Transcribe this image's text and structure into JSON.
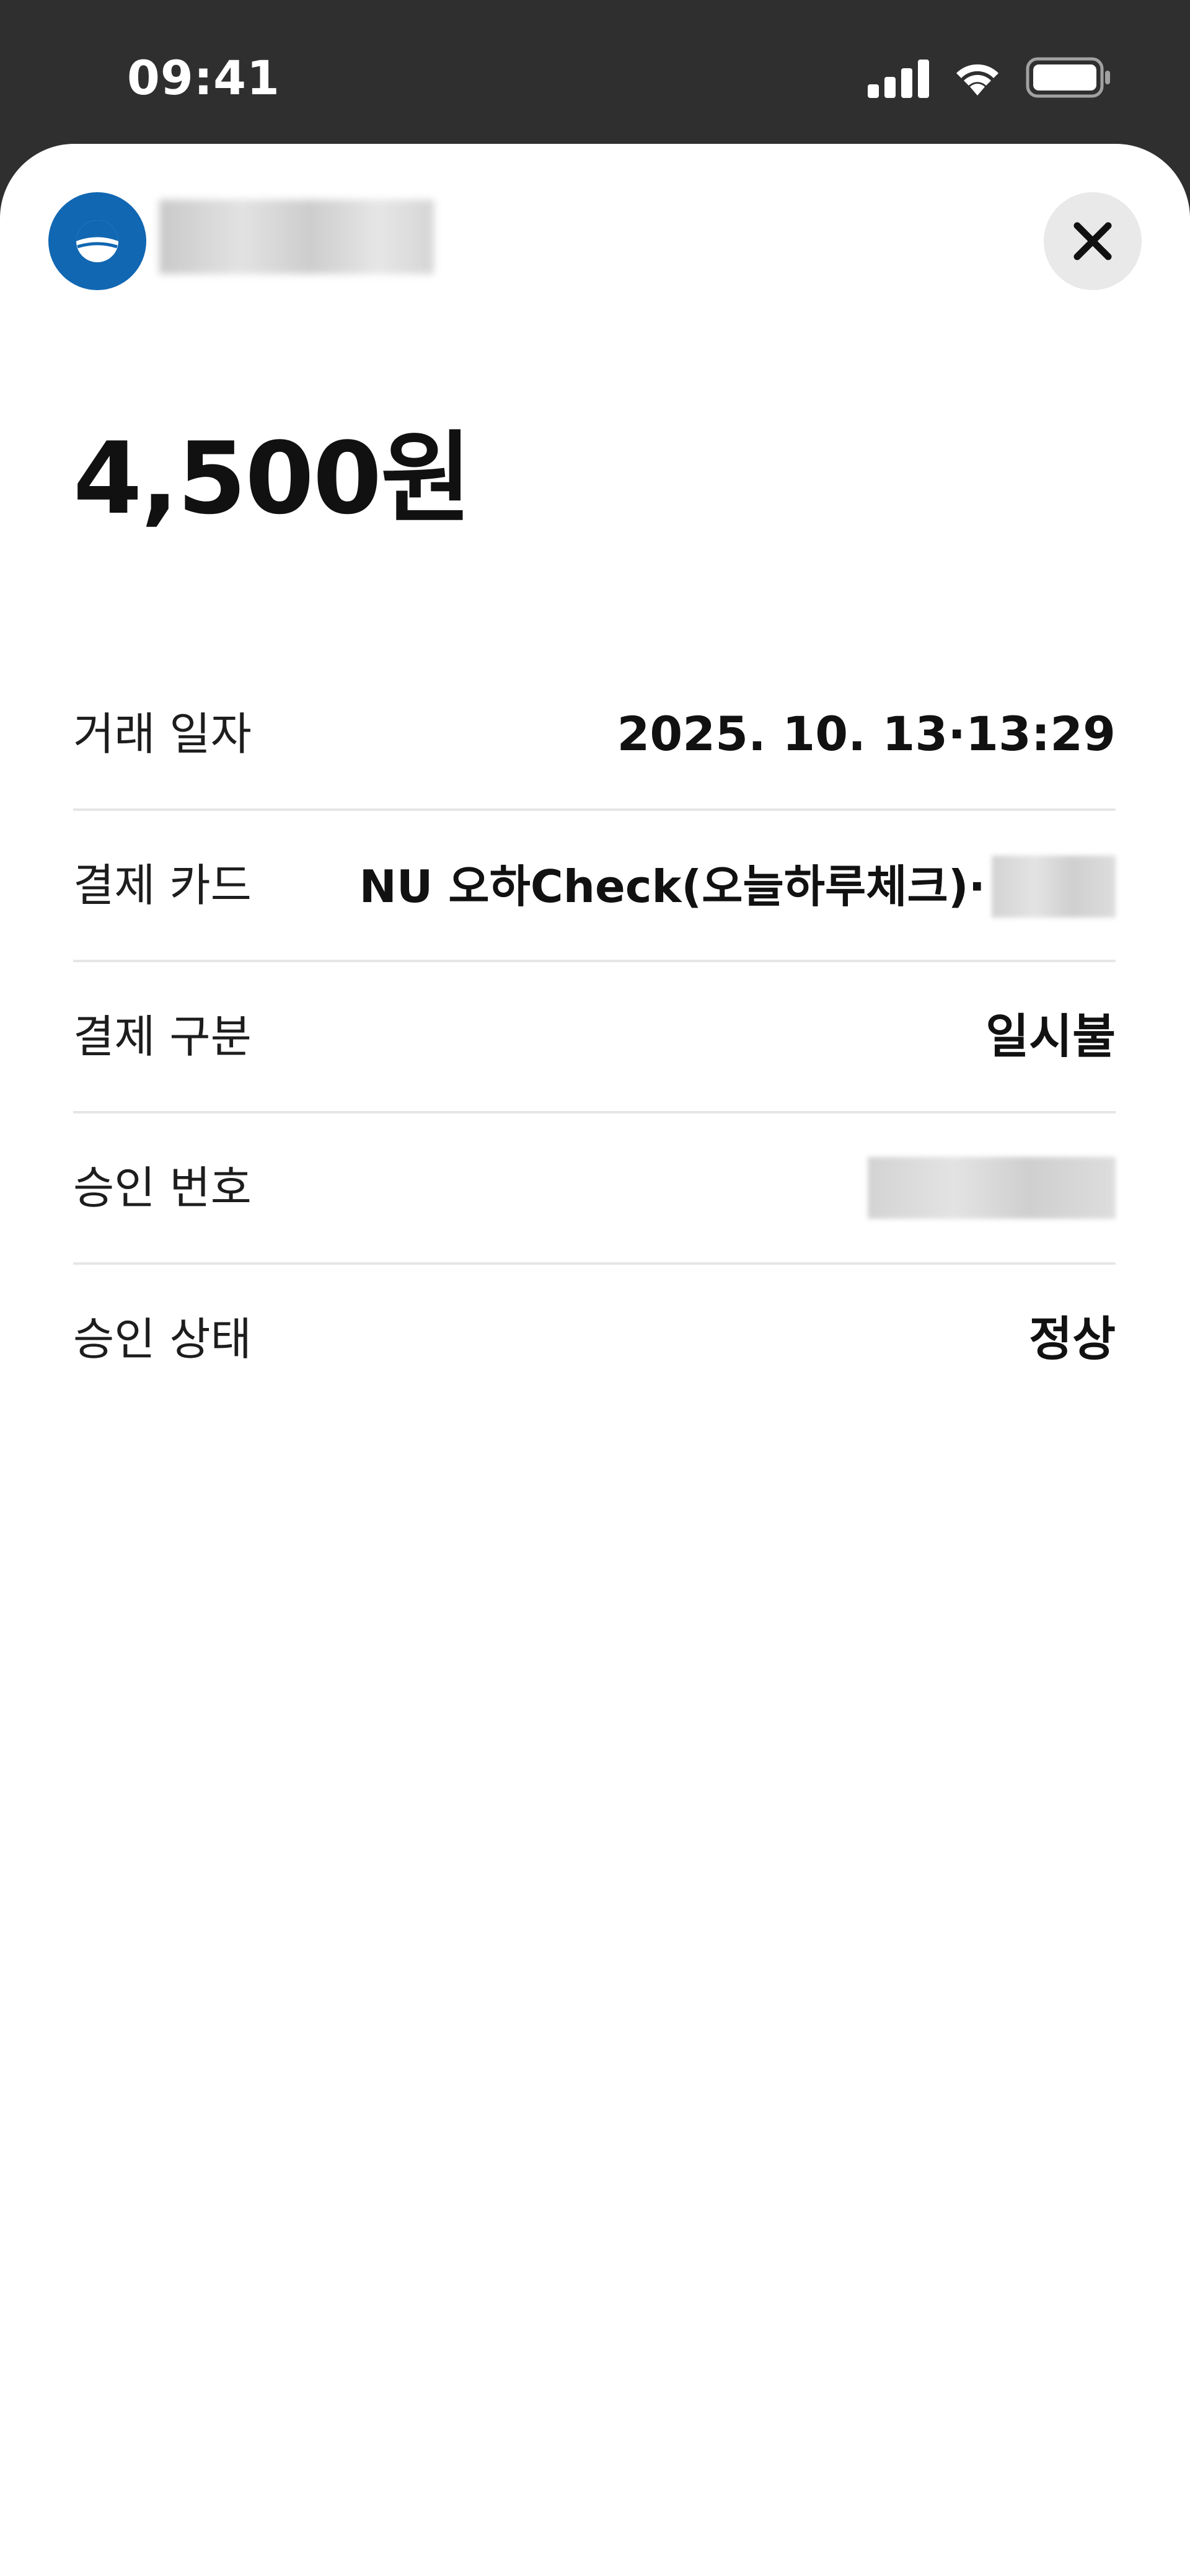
{
  "status_bar": {
    "time": "09:41",
    "icons": [
      "cellular-signal-icon",
      "wifi-icon",
      "battery-icon"
    ]
  },
  "merchant": {
    "logo_icon": "merchant-logo-icon",
    "name_redacted": true
  },
  "close_icon": "close-icon",
  "amount": "4,500원",
  "details": {
    "transaction_date": {
      "label": "거래 일자",
      "value": "2025. 10. 13·13:29"
    },
    "payment_card": {
      "label": "결제 카드",
      "value": "NU 오하Check(오늘하루체크)·"
    },
    "payment_type": {
      "label": "결제 구분",
      "value": "일시불"
    },
    "approval_number": {
      "label": "승인 번호"
    },
    "approval_status": {
      "label": "승인 상태",
      "value": "정상"
    }
  },
  "colors": {
    "status_bar_bg": "#2f2f2f",
    "sheet_bg": "#ffffff",
    "logo_blue": "#1167b2",
    "close_button_bg": "#e9e9e9",
    "divider": "#e6e6e6"
  }
}
